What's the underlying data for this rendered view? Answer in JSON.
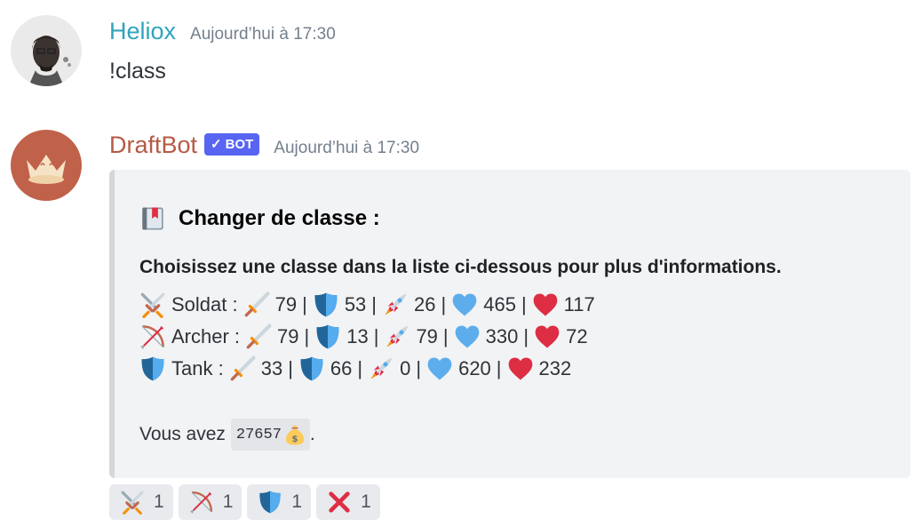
{
  "messages": [
    {
      "author": "Heliox",
      "timestamp": "Aujourd’hui à 17:30",
      "content": "!class"
    },
    {
      "author": "DraftBot",
      "bot_tag": "BOT",
      "timestamp": "Aujourd’hui à 17:30",
      "embed": {
        "title": "Changer de classe :",
        "description_heading": "Choisissez une classe dans la liste ci-dessous pour plus d'informations.",
        "classes": [
          {
            "label": "Soldat :",
            "icon": "crossed-swords-icon",
            "attack": "79",
            "defense": "53",
            "speed": "26",
            "health": "465",
            "fight_power": "117"
          },
          {
            "label": "Archer :",
            "icon": "bow-icon",
            "attack": "79",
            "defense": "13",
            "speed": "79",
            "health": "330",
            "fight_power": "72"
          },
          {
            "label": "Tank :",
            "icon": "shield-icon",
            "attack": "33",
            "defense": "66",
            "speed": "0",
            "health": "620",
            "fight_power": "232"
          }
        ],
        "money_label": "Vous avez",
        "money_value": "27657",
        "money_suffix": "."
      }
    }
  ],
  "reactions": [
    {
      "icon": "crossed-swords-icon",
      "count": "1"
    },
    {
      "icon": "bow-icon",
      "count": "1"
    },
    {
      "icon": "shield-icon",
      "count": "1"
    },
    {
      "icon": "cross-mark-icon",
      "count": "1"
    }
  ],
  "separator": "|"
}
